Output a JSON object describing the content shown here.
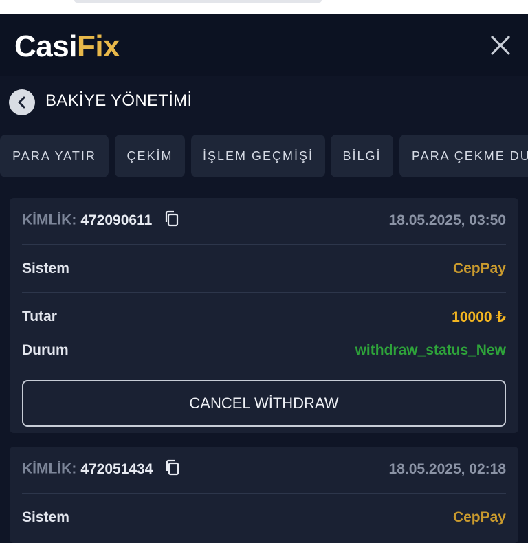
{
  "header": {
    "logo_part1": "Casi",
    "logo_part2": "Fix",
    "close_icon": "close-icon"
  },
  "subbar": {
    "title": "BAKİYE YÖNETİMİ",
    "back_icon": "chevron-left-icon"
  },
  "tabs": [
    "PARA YATIR",
    "ÇEKİM",
    "İŞLEM GEÇMİŞİ",
    "BİLGİ",
    "PARA ÇEKME DU"
  ],
  "transactions": [
    {
      "id_label": "KİMLİK:",
      "id": "472090611",
      "date": "18.05.2025, 03:50",
      "system_label": "Sistem",
      "system": "CepPay",
      "amount_label": "Tutar",
      "amount": "10000 ₺",
      "status_label": "Durum",
      "status": "withdraw_status_New",
      "cancel_label": "CANCEL WİTHDRAW"
    },
    {
      "id_label": "KİMLİK:",
      "id": "472051434",
      "date": "18.05.2025, 02:18",
      "system_label": "Sistem",
      "system": "CepPay"
    }
  ],
  "colors": {
    "brand_gold": "#e8b84a",
    "amount": "#f2b521",
    "status_new": "#2ea33a",
    "background": "#0f1526"
  }
}
